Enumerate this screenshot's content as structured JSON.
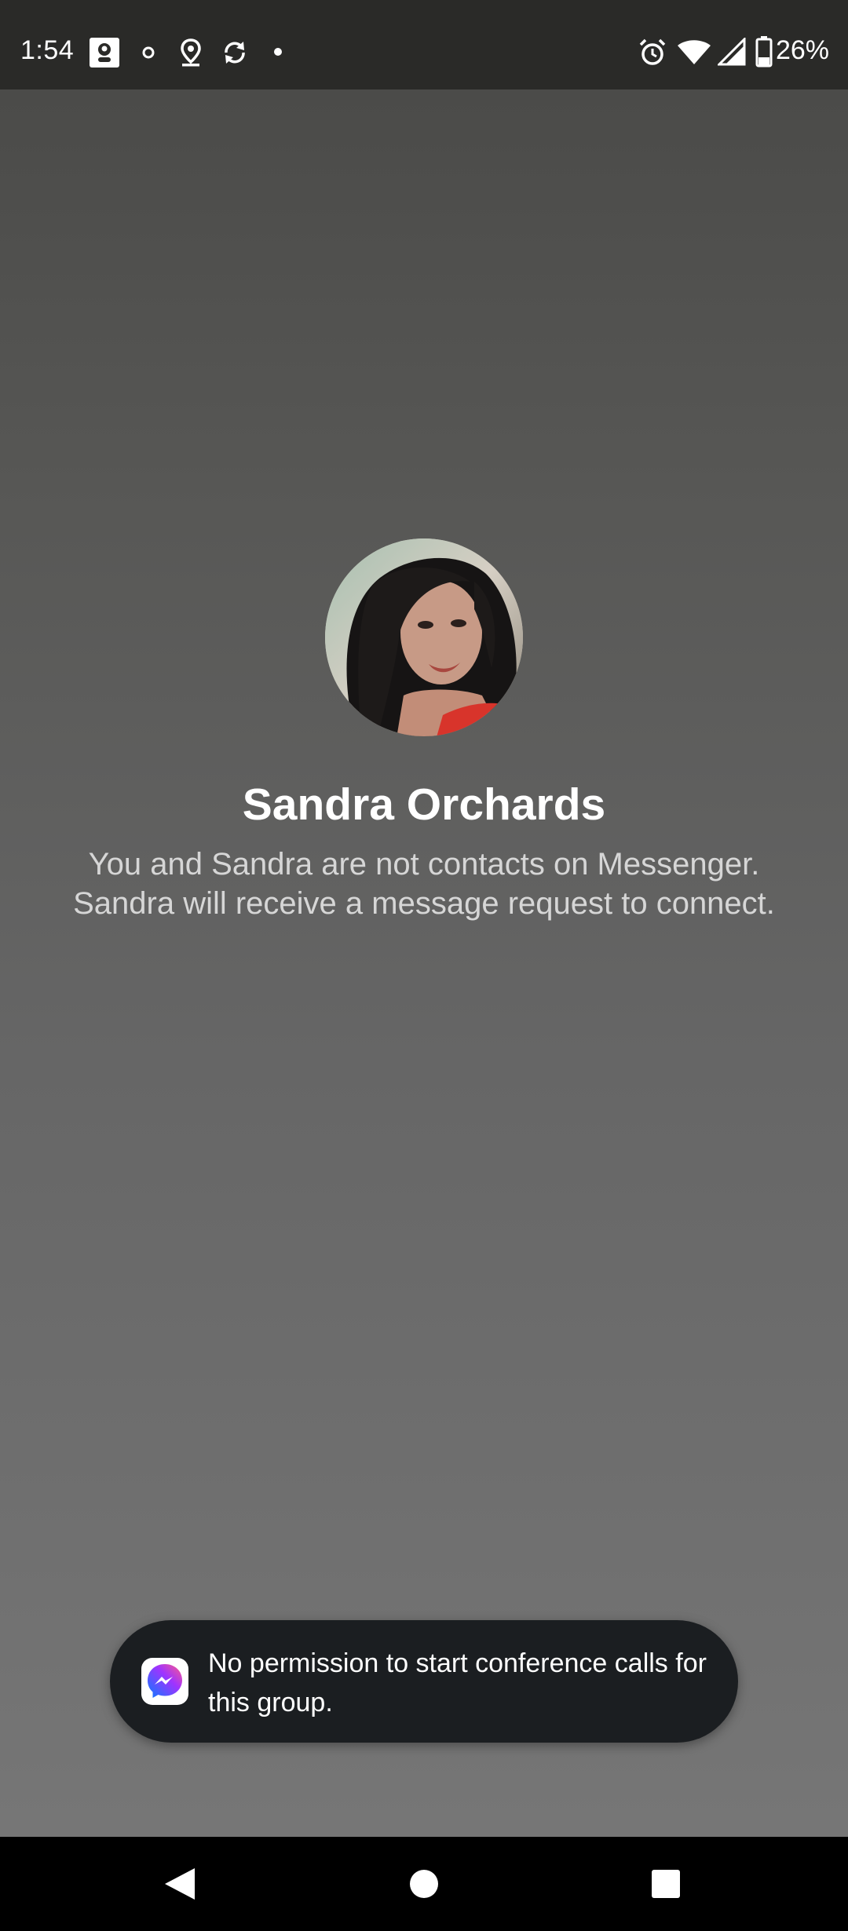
{
  "status_bar": {
    "time": "1:54",
    "battery": "26%",
    "icons": [
      "app-notification-icon",
      "circle-dot-icon",
      "location-icon",
      "sync-icon",
      "small-dot-icon",
      "alarm-icon",
      "wifi-icon",
      "cell-signal-icon",
      "battery-icon"
    ]
  },
  "contact": {
    "name": "Sandra Orchards",
    "note": "You and Sandra are not contacts on Messenger. Sandra will receive a message request to connect."
  },
  "toast": {
    "icon": "messenger-icon",
    "message": "No permission to start conference calls for this group."
  },
  "nav_bar": {
    "buttons": [
      "back-icon",
      "home-icon",
      "recents-icon"
    ]
  },
  "colors": {
    "status_bar_bg": "#2a2a28",
    "toast_bg": "#1b1e21",
    "messenger_gradient_start": "#0a7cff",
    "messenger_gradient_end": "#a033ff",
    "nav_bar_bg": "#000000"
  }
}
